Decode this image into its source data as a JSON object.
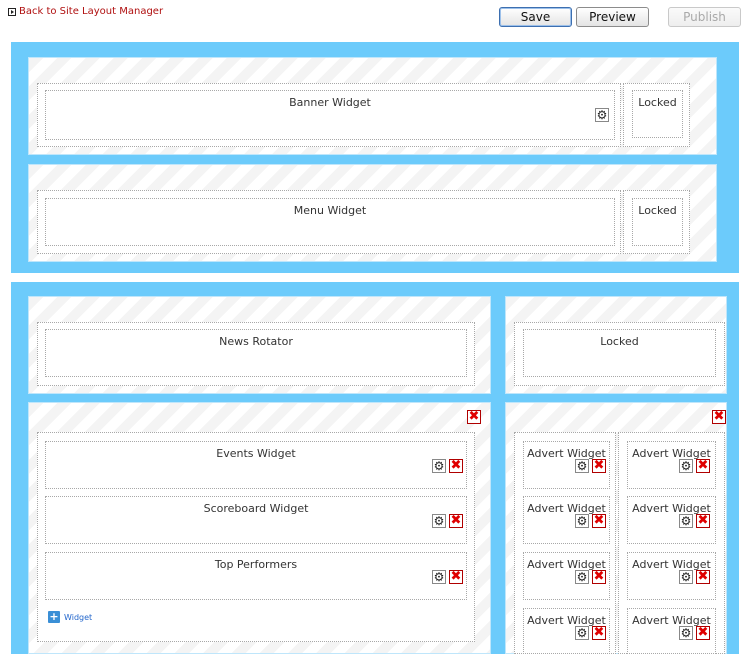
{
  "toolbar": {
    "back_label": "Back to Site Layout Manager",
    "save_label": "Save",
    "preview_label": "Preview",
    "publish_label": "Publish"
  },
  "header_section": {
    "banner_label": "Banner Widget",
    "banner_locked": "Locked",
    "menu_label": "Menu Widget",
    "menu_locked": "Locked"
  },
  "body_section": {
    "news_label": "News Rotator",
    "right_locked": "Locked",
    "left_widgets": [
      "Events Widget",
      "Scoreboard Widget",
      "Top Performers"
    ],
    "add_widget_label": "Widget",
    "advert_label": "Advert Widget"
  },
  "icons": {
    "back": "play-square-icon",
    "settings": "gear-icon",
    "remove": "close-red-icon",
    "add": "plus-icon"
  }
}
